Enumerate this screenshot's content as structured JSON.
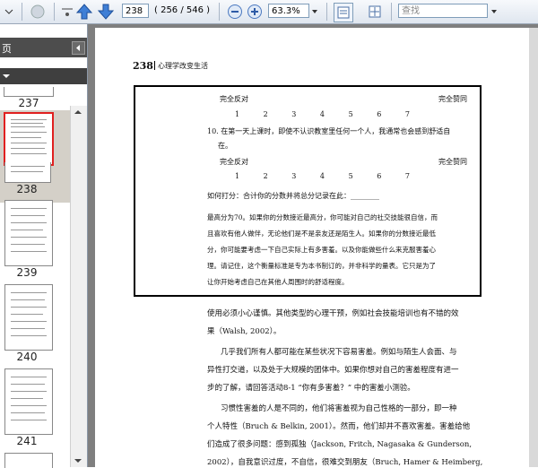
{
  "toolbar": {
    "page_input": "238",
    "page_count": "( 256 / 546 )",
    "zoom": "63.3%",
    "search_placeholder": "查找"
  },
  "sidebar": {
    "panel_title": "页面",
    "thumbnails": [
      {
        "label": "237"
      },
      {
        "label": "238"
      },
      {
        "label": "239"
      },
      {
        "label": "240"
      },
      {
        "label": "241"
      }
    ]
  },
  "page": {
    "header_number": "238",
    "header_title": "心理学改变生活",
    "box": {
      "row1_left": "完全反对",
      "row1_right": "完全赞同",
      "scale": [
        "1",
        "2",
        "3",
        "4",
        "5",
        "6",
        "7"
      ],
      "q10_line1": "10. 在第一天上课时，即使不认识教室里任何一个人，我通常也会感到舒适自",
      "q10_line2": "在。",
      "row2_left": "完全反对",
      "row2_right": "完全赞同",
      "score_label": "如何打分：合计你的分数并将总分记录在此：________",
      "para1": "最高分为70。如果你的分数接近最高分，你可能对自己的社交技能很自信，而",
      "para2": "且喜欢有他人做伴，无论他们是不是亲友还是陌生人。如果你的分数接近最低",
      "para3": "分，你可能要考虑一下自己实际上有多害羞。以及你能做些什么来克服害羞心",
      "para4": "理。请记住，这个衡量标准是专为本书制订的，并非科学的量表。它只是为了",
      "para5": "让你开始考虑自己在其他人周围时的舒适程度。"
    },
    "body": [
      "使用必须小心谨慎。其他类型的心理干预，例如社会技能培训也有不错的效",
      "果（Walsh, 2002）。",
      "几乎我们所有人都可能在某些状况下容易害羞。例如与陌生人会面、与",
      "异性打交道，以及处于大规模的团体中。如果你想对自己的害羞程度有进一",
      "步的了解，请回答活动8-1 “你有多害羞？” 中的害羞小测验。",
      "习惯性害羞的人是不同的，他们将害羞视为自己性格的一部分，即一种",
      "个人特性（Bruch & Belkin, 2001）。然而，他们却并不喜欢害羞。害羞给他",
      "们造成了很多问题：感到孤独（Jackson, Fritch, Nagasaka & Gunderson,",
      "2002），自我意识过度，不自信，很难交到朋友（Bruch, Hamer & Heimberg,"
    ]
  },
  "colors": {
    "selected_thumb_border": "#e02020",
    "toolbar_bg": "#e6ecf3"
  }
}
